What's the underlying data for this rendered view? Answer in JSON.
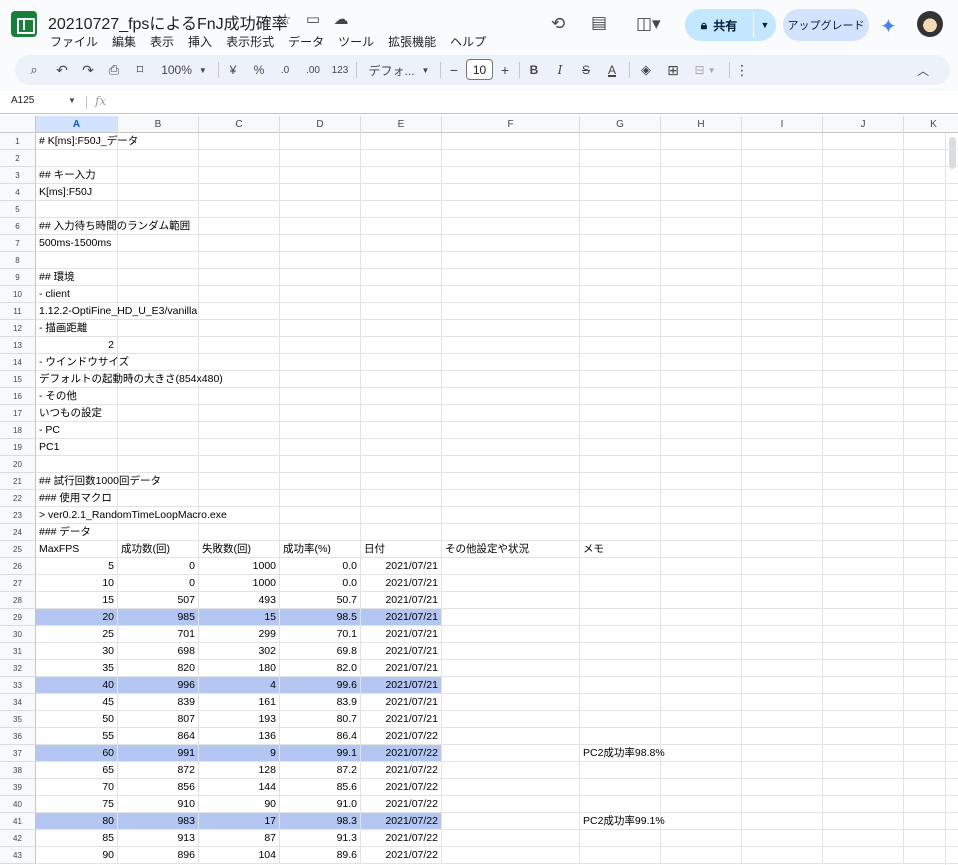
{
  "app": {
    "doc_title": "20210727_fpsによるFnJ成功確率",
    "menu": [
      "ファイル",
      "編集",
      "表示",
      "挿入",
      "表示形式",
      "データ",
      "ツール",
      "拡張機能",
      "ヘルプ"
    ],
    "share_label": "共有",
    "upgrade_label": "アップグレード"
  },
  "toolbar": {
    "zoom": "100%",
    "currency": "¥",
    "percent": "%",
    "dec_decrease": ".0",
    "dec_increase": ".00",
    "number_format": "123",
    "font": "デフォ...",
    "font_size": "10",
    "minus": "−",
    "plus": "+",
    "bold": "B",
    "italic": "I",
    "strike": "S",
    "text_color": "A"
  },
  "formula": {
    "cell_ref": "A125",
    "fx": "fx"
  },
  "columns": [
    "A",
    "B",
    "C",
    "D",
    "E",
    "F",
    "G",
    "H",
    "I",
    "J",
    "K"
  ],
  "rows": [
    {
      "n": "1",
      "cells": [
        "# K[ms]:F50J_データ"
      ]
    },
    {
      "n": "2",
      "cells": []
    },
    {
      "n": "3",
      "cells": [
        "## キー入力"
      ]
    },
    {
      "n": "4",
      "cells": [
        "K[ms]:F50J"
      ]
    },
    {
      "n": "5",
      "cells": []
    },
    {
      "n": "6",
      "cells": [
        "## 入力待ち時間のランダム範囲"
      ]
    },
    {
      "n": "7",
      "cells": [
        "500ms-1500ms"
      ]
    },
    {
      "n": "8",
      "cells": []
    },
    {
      "n": "9",
      "cells": [
        "## 環境"
      ]
    },
    {
      "n": "10",
      "cells": [
        "- client"
      ]
    },
    {
      "n": "11",
      "cells": [
        "1.12.2-OptiFine_HD_U_E3/vanilla"
      ]
    },
    {
      "n": "12",
      "cells": [
        "- 描画距離"
      ]
    },
    {
      "n": "13",
      "cells": [
        "2"
      ],
      "numA": true
    },
    {
      "n": "14",
      "cells": [
        "- ウインドウサイズ"
      ]
    },
    {
      "n": "15",
      "cells": [
        "デフォルトの起動時の大きさ(854x480)"
      ]
    },
    {
      "n": "16",
      "cells": [
        "- その他"
      ]
    },
    {
      "n": "17",
      "cells": [
        "いつもの設定"
      ]
    },
    {
      "n": "18",
      "cells": [
        "- PC"
      ]
    },
    {
      "n": "19",
      "cells": [
        "PC1"
      ]
    },
    {
      "n": "20",
      "cells": []
    },
    {
      "n": "21",
      "cells": [
        "## 試行回数1000回データ"
      ]
    },
    {
      "n": "22",
      "cells": [
        "### 使用マクロ"
      ]
    },
    {
      "n": "23",
      "cells": [
        "> ver0.2.1_RandomTimeLoopMacro.exe"
      ]
    },
    {
      "n": "24",
      "cells": [
        "### データ"
      ]
    },
    {
      "n": "25",
      "cells": [
        "MaxFPS",
        "成功数(回)",
        "失敗数(回)",
        "成功率(%)",
        "日付",
        "その他設定や状況",
        "メモ"
      ]
    },
    {
      "n": "26",
      "data": [
        "5",
        "0",
        "1000",
        "0.0",
        "2021/07/21"
      ]
    },
    {
      "n": "27",
      "data": [
        "10",
        "0",
        "1000",
        "0.0",
        "2021/07/21"
      ]
    },
    {
      "n": "28",
      "data": [
        "15",
        "507",
        "493",
        "50.7",
        "2021/07/21"
      ]
    },
    {
      "n": "29",
      "data": [
        "20",
        "985",
        "15",
        "98.5",
        "2021/07/21"
      ],
      "hl": true
    },
    {
      "n": "30",
      "data": [
        "25",
        "701",
        "299",
        "70.1",
        "2021/07/21"
      ]
    },
    {
      "n": "31",
      "data": [
        "30",
        "698",
        "302",
        "69.8",
        "2021/07/21"
      ]
    },
    {
      "n": "32",
      "data": [
        "35",
        "820",
        "180",
        "82.0",
        "2021/07/21"
      ]
    },
    {
      "n": "33",
      "data": [
        "40",
        "996",
        "4",
        "99.6",
        "2021/07/21"
      ],
      "hl": true
    },
    {
      "n": "34",
      "data": [
        "45",
        "839",
        "161",
        "83.9",
        "2021/07/21"
      ]
    },
    {
      "n": "35",
      "data": [
        "50",
        "807",
        "193",
        "80.7",
        "2021/07/21"
      ]
    },
    {
      "n": "36",
      "data": [
        "55",
        "864",
        "136",
        "86.4",
        "2021/07/22"
      ]
    },
    {
      "n": "37",
      "data": [
        "60",
        "991",
        "9",
        "99.1",
        "2021/07/22"
      ],
      "hl": true,
      "memo": "PC2成功率98.8%"
    },
    {
      "n": "38",
      "data": [
        "65",
        "872",
        "128",
        "87.2",
        "2021/07/22"
      ]
    },
    {
      "n": "39",
      "data": [
        "70",
        "856",
        "144",
        "85.6",
        "2021/07/22"
      ]
    },
    {
      "n": "40",
      "data": [
        "75",
        "910",
        "90",
        "91.0",
        "2021/07/22"
      ]
    },
    {
      "n": "41",
      "data": [
        "80",
        "983",
        "17",
        "98.3",
        "2021/07/22"
      ],
      "hl": true,
      "memo": "PC2成功率99.1%"
    },
    {
      "n": "42",
      "data": [
        "85",
        "913",
        "87",
        "91.3",
        "2021/07/22"
      ]
    },
    {
      "n": "43",
      "data": [
        "90",
        "896",
        "104",
        "89.6",
        "2021/07/22"
      ]
    }
  ]
}
